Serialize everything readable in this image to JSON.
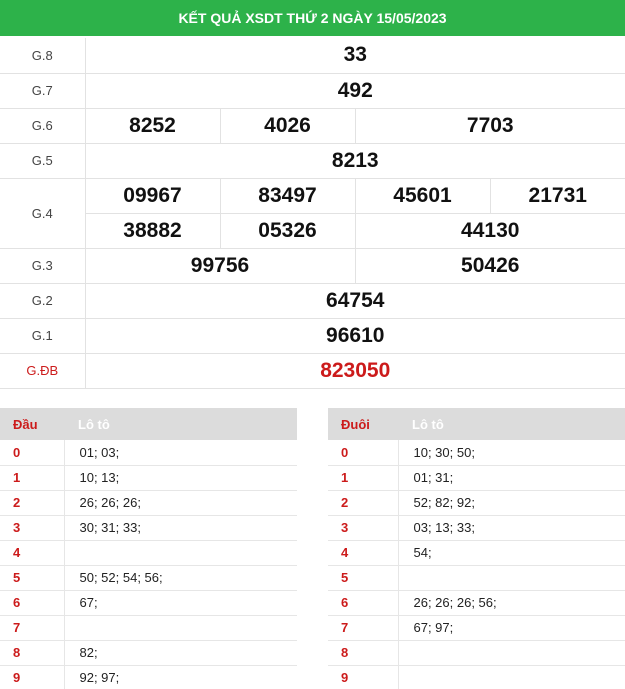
{
  "title": "KẾT QUẢ XSDT THỨ 2 NGÀY 15/05/2023",
  "prizes": {
    "g8": {
      "label": "G.8",
      "values": [
        "33"
      ]
    },
    "g7": {
      "label": "G.7",
      "values": [
        "492"
      ]
    },
    "g6": {
      "label": "G.6",
      "values": [
        "8252",
        "4026",
        "7703"
      ]
    },
    "g5": {
      "label": "G.5",
      "values": [
        "8213"
      ]
    },
    "g4": {
      "label": "G.4",
      "values": [
        "09967",
        "83497",
        "45601",
        "21731",
        "38882",
        "05326",
        "44130"
      ]
    },
    "g3": {
      "label": "G.3",
      "values": [
        "99756",
        "50426"
      ]
    },
    "g2": {
      "label": "G.2",
      "values": [
        "64754"
      ]
    },
    "g1": {
      "label": "G.1",
      "values": [
        "96610"
      ]
    },
    "gdb": {
      "label": "G.ĐB",
      "values": [
        "823050"
      ]
    }
  },
  "dau": {
    "header_key": "Đầu",
    "header_val": "Lô tô",
    "rows": [
      {
        "key": "0",
        "val": "01; 03;"
      },
      {
        "key": "1",
        "val": "10; 13;"
      },
      {
        "key": "2",
        "val": "26; 26; 26;"
      },
      {
        "key": "3",
        "val": "30; 31; 33;"
      },
      {
        "key": "4",
        "val": ""
      },
      {
        "key": "5",
        "val": "50; 52; 54; 56;"
      },
      {
        "key": "6",
        "val": "67;"
      },
      {
        "key": "7",
        "val": ""
      },
      {
        "key": "8",
        "val": "82;"
      },
      {
        "key": "9",
        "val": "92; 97;"
      }
    ]
  },
  "duoi": {
    "header_key": "Đuôi",
    "header_val": "Lô tô",
    "rows": [
      {
        "key": "0",
        "val": "10; 30; 50;"
      },
      {
        "key": "1",
        "val": "01; 31;"
      },
      {
        "key": "2",
        "val": "52; 82; 92;"
      },
      {
        "key": "3",
        "val": "03; 13; 33;"
      },
      {
        "key": "4",
        "val": "54;"
      },
      {
        "key": "5",
        "val": ""
      },
      {
        "key": "6",
        "val": "26; 26; 26; 56;"
      },
      {
        "key": "7",
        "val": "67; 97;"
      },
      {
        "key": "8",
        "val": ""
      },
      {
        "key": "9",
        "val": ""
      }
    ]
  },
  "colors": {
    "header_bg": "#2db24a",
    "special_red": "#cc1b1b",
    "table_header_bg": "#dcdcdc"
  }
}
